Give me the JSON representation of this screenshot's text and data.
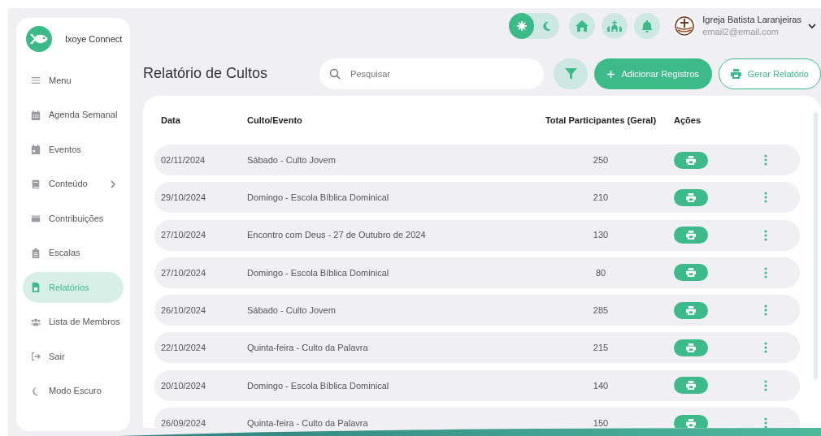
{
  "sidebar": {
    "brand": "Ixoye Connect",
    "items": [
      {
        "label": "Menu",
        "selected": false,
        "expandable": false
      },
      {
        "label": "Agenda Semanal",
        "selected": false,
        "expandable": false
      },
      {
        "label": "Eventos",
        "selected": false,
        "expandable": false
      },
      {
        "label": "Conteúdo",
        "selected": false,
        "expandable": true
      },
      {
        "label": "Contribuições",
        "selected": false,
        "expandable": false
      },
      {
        "label": "Escalas",
        "selected": false,
        "expandable": false
      },
      {
        "label": "Relatórios",
        "selected": true,
        "expandable": false
      },
      {
        "label": "Lista de Membros",
        "selected": false,
        "expandable": false
      },
      {
        "label": "Sair",
        "selected": false,
        "expandable": false
      },
      {
        "label": "Modo Escuro",
        "selected": false,
        "expandable": false
      }
    ]
  },
  "header": {
    "theme_toggle": {
      "dark": false
    },
    "user": {
      "name": "Igreja Batista Laranjeiras",
      "email": "email2@email.com"
    }
  },
  "page": {
    "title": "Relatório de Cultos",
    "search": {
      "placeholder": "Pesquisar"
    },
    "add_button": "Adicionar Registros",
    "report_button": "Gerar Relatório"
  },
  "table": {
    "columns": [
      "Data",
      "Culto/Evento",
      "Total Participantes (Geral)",
      "Ações"
    ],
    "rows": [
      {
        "date": "02/11/2024",
        "event": "Sábado - Culto Jovem",
        "total": "250"
      },
      {
        "date": "29/10/2024",
        "event": "Domingo - Escola Bíblica Dominical",
        "total": "210"
      },
      {
        "date": "27/10/2024",
        "event": "Encontro com Deus - 27 de Outubro de 2024",
        "total": "130"
      },
      {
        "date": "27/10/2024",
        "event": "Domingo - Escola Bíblica Dominical",
        "total": "80"
      },
      {
        "date": "26/10/2024",
        "event": "Sábado - Culto Jovem",
        "total": "285"
      },
      {
        "date": "22/10/2024",
        "event": "Quinta-feira - Culto da Palavra",
        "total": "215"
      },
      {
        "date": "20/10/2024",
        "event": "Domingo - Escola Bíblica Dominical",
        "total": "140"
      },
      {
        "date": "26/09/2024",
        "event": "Quinta-feira - Culto da Palavra",
        "total": "150"
      }
    ]
  }
}
